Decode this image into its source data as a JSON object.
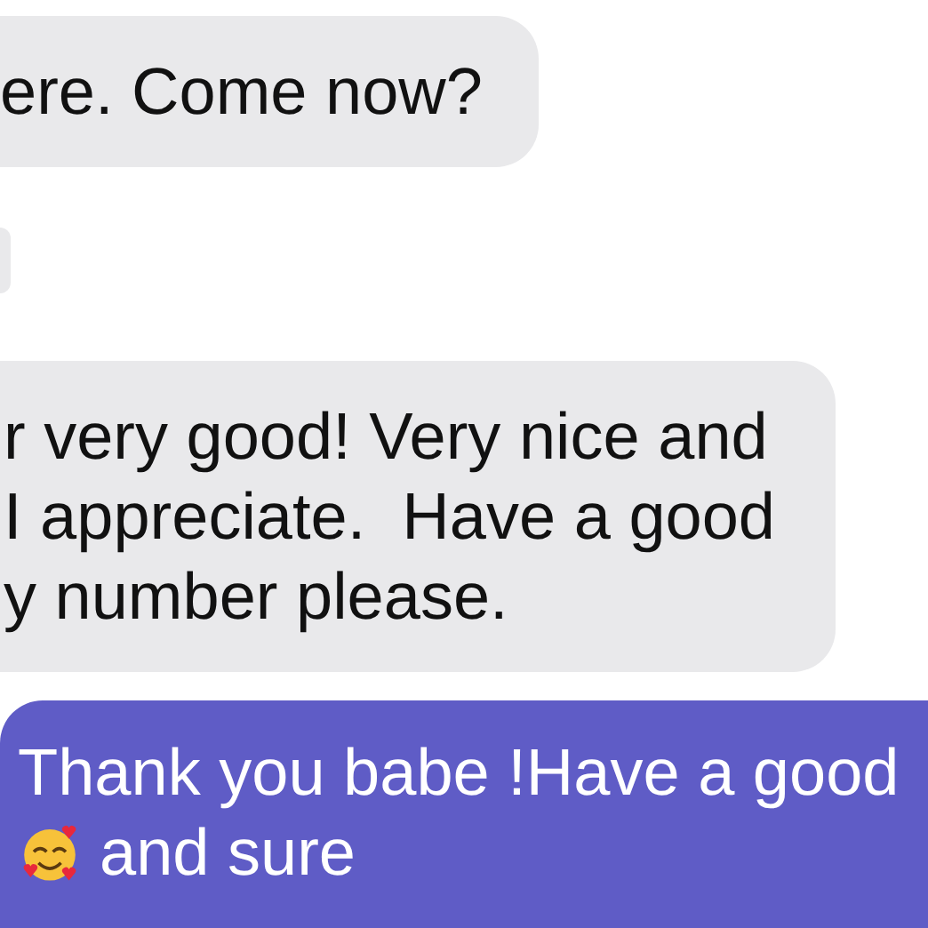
{
  "messages": [
    {
      "kind": "received",
      "lines": [
        {
          "text": "ere. Come now?"
        }
      ]
    },
    {
      "kind": "received"
    },
    {
      "kind": "received",
      "lines": [
        {
          "text": "r very good! Very nice and"
        },
        {
          "text": "I appreciate.  Have a good"
        },
        {
          "text": "y number please."
        }
      ]
    },
    {
      "kind": "sent",
      "lines": [
        {
          "text": "Thank you babe !Have a good"
        },
        {
          "text": "and sure",
          "emoji": true
        }
      ]
    }
  ]
}
